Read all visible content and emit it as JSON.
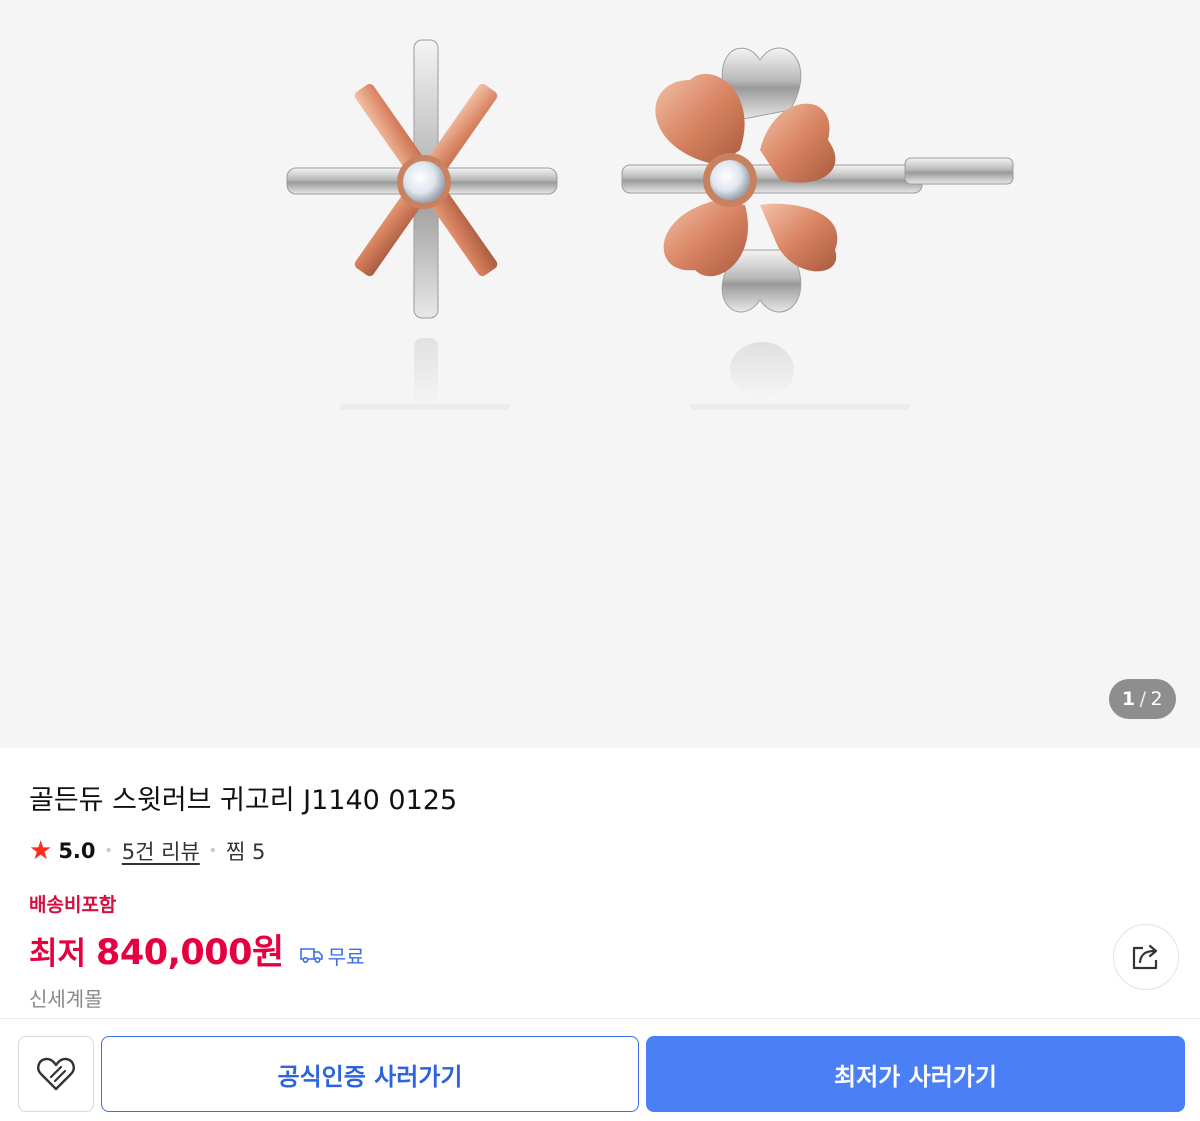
{
  "gallery": {
    "image_alt": "골든듀 스윗러브 귀고리 product image",
    "current_page": "1",
    "separator": "/",
    "total_pages": "2"
  },
  "product": {
    "title": "골든듀 스윗러브 귀고리 J1140 0125",
    "rating": "5.0",
    "review_link": "5건 리뷰",
    "wish_label": "찜 5",
    "shipping_note": "배송비포함",
    "price_prefix": "최저",
    "price": "840,000원",
    "delivery_label": "무료",
    "seller": "신세계몰"
  },
  "actions": {
    "official_button": "공식인증 사러가기",
    "lowest_button": "최저가 사러가기"
  },
  "colors": {
    "price": "#e5003f",
    "accent_blue": "#4a7ff5",
    "star": "#ff2a1f"
  },
  "icons": [
    "star-icon",
    "truck-icon",
    "share-icon",
    "heart-icon"
  ]
}
